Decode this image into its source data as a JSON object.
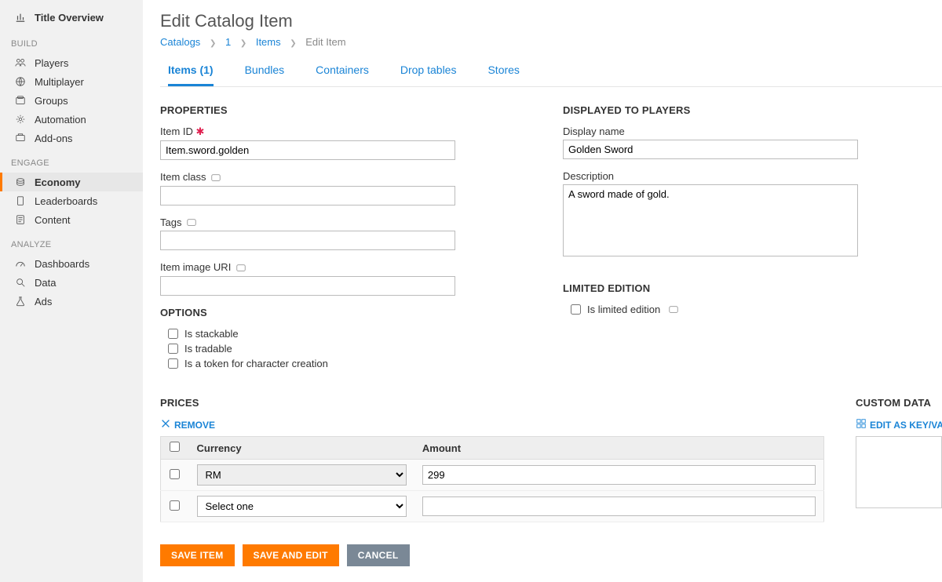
{
  "sidebar": {
    "title": "Title Overview",
    "groups": [
      {
        "label": "BUILD",
        "items": [
          {
            "label": "Players"
          },
          {
            "label": "Multiplayer"
          },
          {
            "label": "Groups"
          },
          {
            "label": "Automation"
          },
          {
            "label": "Add-ons"
          }
        ]
      },
      {
        "label": "ENGAGE",
        "items": [
          {
            "label": "Economy",
            "active": true
          },
          {
            "label": "Leaderboards"
          },
          {
            "label": "Content"
          }
        ]
      },
      {
        "label": "ANALYZE",
        "items": [
          {
            "label": "Dashboards"
          },
          {
            "label": "Data"
          },
          {
            "label": "Ads"
          }
        ]
      }
    ]
  },
  "page": {
    "title": "Edit Catalog Item",
    "breadcrumb": {
      "catalogs": "Catalogs",
      "one": "1",
      "items": "Items",
      "current": "Edit Item"
    }
  },
  "tabs": [
    {
      "label": "Items (1)",
      "active": true
    },
    {
      "label": "Bundles"
    },
    {
      "label": "Containers"
    },
    {
      "label": "Drop tables"
    },
    {
      "label": "Stores"
    }
  ],
  "sections": {
    "properties": "PROPERTIES",
    "displayed": "DISPLAYED TO PLAYERS",
    "options": "OPTIONS",
    "limited": "LIMITED EDITION",
    "prices": "PRICES",
    "custom": "CUSTOM DATA"
  },
  "form": {
    "itemIdLabel": "Item ID",
    "itemId": "Item.sword.golden",
    "itemClassLabel": "Item class",
    "itemClass": "",
    "tagsLabel": "Tags",
    "tags": "",
    "imageUriLabel": "Item image URI",
    "imageUri": "",
    "displayNameLabel": "Display name",
    "displayName": "Golden Sword",
    "descriptionLabel": "Description",
    "description": "A sword made of gold."
  },
  "options": {
    "stackable": "Is stackable",
    "tradable": "Is tradable",
    "token": "Is a token for character creation",
    "limitedEdition": "Is limited edition"
  },
  "prices": {
    "removeLabel": "REMOVE",
    "kvLabel": "EDIT AS KEY/VA",
    "headers": {
      "currency": "Currency",
      "amount": "Amount"
    },
    "rows": [
      {
        "currency": "RM",
        "amount": "299"
      },
      {
        "currency": "Select one",
        "amount": ""
      }
    ]
  },
  "buttons": {
    "save": "SAVE ITEM",
    "saveEdit": "SAVE AND EDIT",
    "cancel": "CANCEL"
  }
}
